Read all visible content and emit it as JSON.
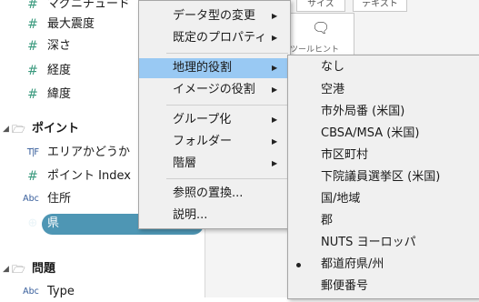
{
  "data_pane": {
    "fields_top": [
      {
        "icon": "hash-icon",
        "label": "マグニチュード"
      },
      {
        "icon": "hash-icon",
        "label": "最大震度"
      },
      {
        "icon": "hash-icon",
        "label": "深さ"
      },
      {
        "icon": "hash-icon",
        "label": "経度"
      },
      {
        "icon": "hash-icon",
        "label": "緯度"
      }
    ],
    "group1": {
      "label": "ポイント"
    },
    "group1_fields": [
      {
        "icon": "T|F",
        "label": "エリアかどうか"
      },
      {
        "icon": "hash-icon",
        "label": "ポイント Index"
      },
      {
        "icon": "Abc",
        "label": "住所"
      },
      {
        "icon": "globe-icon",
        "label": "県"
      }
    ],
    "group2": {
      "label": "問題"
    },
    "group2_fields": [
      {
        "icon": "Abc",
        "label": "Type"
      }
    ]
  },
  "background": {
    "btn1": "サイズ",
    "btn2": "テキスト",
    "card_label": "ツールヒント"
  },
  "context_menu": {
    "items": [
      {
        "label": "データ型の変更",
        "submenu": true
      },
      {
        "label": "既定のプロパティ",
        "submenu": true
      },
      {
        "label": "地理的役割",
        "submenu": true,
        "highlighted": true
      },
      {
        "label": "イメージの役割",
        "submenu": true
      },
      {
        "label": "グループ化",
        "submenu": true
      },
      {
        "label": "フォルダー",
        "submenu": true
      },
      {
        "label": "階層",
        "submenu": true
      },
      {
        "label": "参照の置換...",
        "submenu": false
      },
      {
        "label": "説明...",
        "submenu": false
      }
    ]
  },
  "geo_submenu": {
    "items": [
      {
        "label": "なし",
        "checked": false
      },
      {
        "label": "空港",
        "checked": false
      },
      {
        "label": "市外局番 (米国)",
        "checked": false
      },
      {
        "label": "CBSA/MSA (米国)",
        "checked": false
      },
      {
        "label": "市区町村",
        "checked": false
      },
      {
        "label": "下院議員選挙区 (米国)",
        "checked": false
      },
      {
        "label": "国/地域",
        "checked": false
      },
      {
        "label": "郡",
        "checked": false
      },
      {
        "label": "NUTS ヨーロッパ",
        "checked": false
      },
      {
        "label": "都道府県/州",
        "checked": true
      },
      {
        "label": "郵便番号",
        "checked": false
      }
    ]
  }
}
